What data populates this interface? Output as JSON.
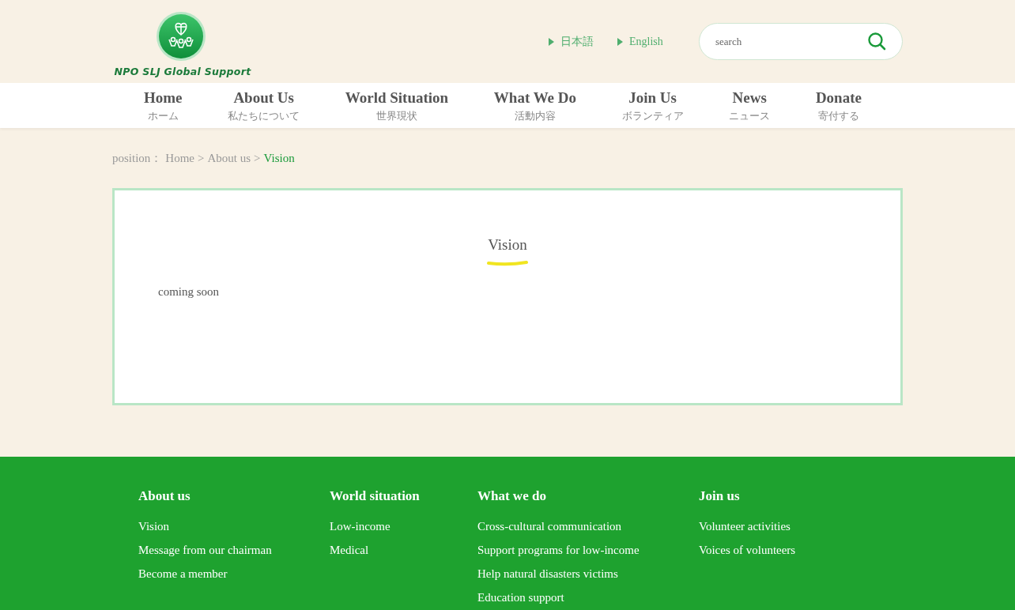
{
  "header": {
    "logo_text": "NPO SLJ Global Support",
    "languages": [
      "日本語",
      "English"
    ],
    "search": {
      "placeholder": "search"
    }
  },
  "nav": [
    {
      "label": "Home",
      "sub": "ホーム"
    },
    {
      "label": "About Us",
      "sub": "私たちについて"
    },
    {
      "label": "World Situation",
      "sub": "世界現状"
    },
    {
      "label": "What We Do",
      "sub": "活動内容"
    },
    {
      "label": "Join Us",
      "sub": "ボランティア"
    },
    {
      "label": "News",
      "sub": "ニュース"
    },
    {
      "label": "Donate",
      "sub": "寄付する"
    }
  ],
  "breadcrumb": {
    "prefix": "position：",
    "items": [
      "Home",
      "About us",
      "Vision"
    ],
    "separator": ">"
  },
  "content": {
    "title": "Vision",
    "body": "coming soon"
  },
  "footer": [
    {
      "heading": "About us",
      "links": [
        "Vision",
        "Message from our chairman",
        "Become a member"
      ]
    },
    {
      "heading": "World situation",
      "links": [
        "Low-income",
        "Medical"
      ]
    },
    {
      "heading": "What we do",
      "links": [
        "Cross-cultural communication",
        "Support programs for low-income",
        "Help natural disasters victims",
        "Education support"
      ]
    },
    {
      "heading": "Join us",
      "links": [
        "Volunteer activities",
        "Voices of volunteers"
      ]
    }
  ]
}
